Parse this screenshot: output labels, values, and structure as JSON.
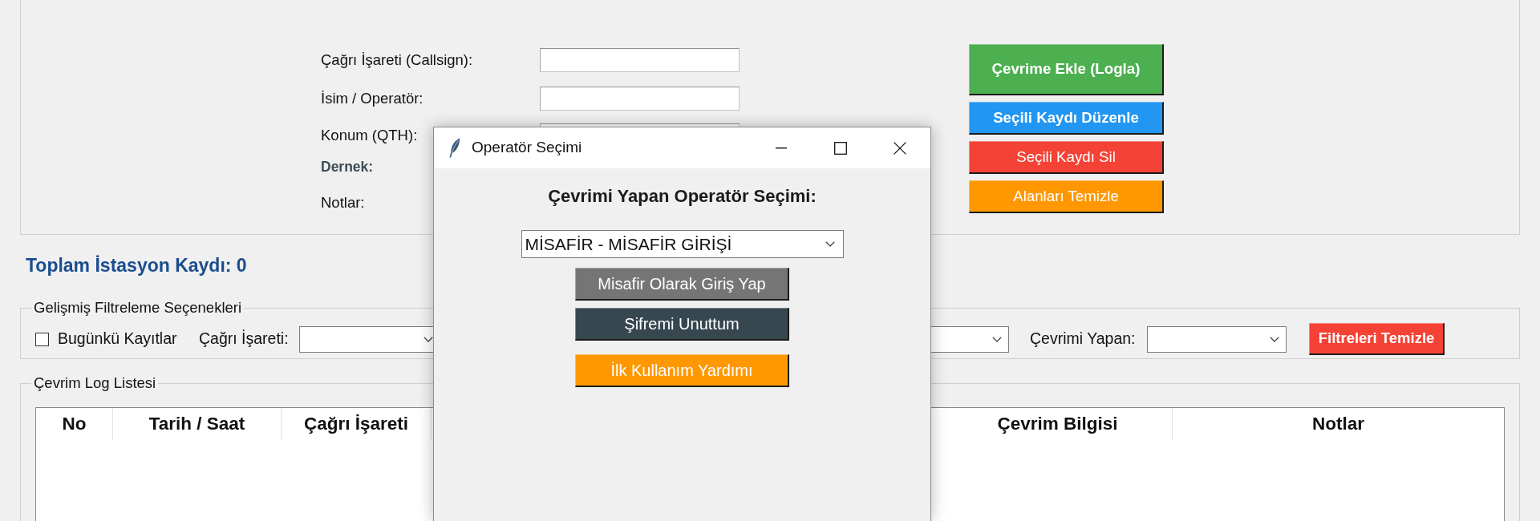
{
  "entry_form": {
    "fields": [
      {
        "label": "Çağrı İşareti (Callsign):",
        "kind": "entry"
      },
      {
        "label": "İsim / Operatör:",
        "kind": "entry"
      },
      {
        "label": "Konum (QTH):",
        "kind": "entry"
      },
      {
        "label": "Dernek:",
        "kind": "emphasis"
      },
      {
        "label": "Notlar:",
        "kind": "plain"
      }
    ],
    "actions": [
      {
        "label": "Çevrime Ekle (Logla)",
        "kind": "large",
        "bold": true,
        "color": "#4caf50"
      },
      {
        "label": "Seçili Kaydı Düzenle",
        "kind": "normal",
        "bold": true,
        "color": "#2196f3"
      },
      {
        "label": "Seçili Kaydı Sil",
        "kind": "normal",
        "bold": false,
        "color": "#f44336"
      },
      {
        "label": "Alanları Temizle",
        "kind": "normal",
        "bold": false,
        "color": "#ff9800"
      }
    ]
  },
  "record_count": "Toplam İstasyon Kaydı: 0",
  "filters": {
    "title": "Gelişmiş Filtreleme Seçenekleri",
    "items": [
      {
        "kind": "checkbox",
        "label": "Bugünkü Kayıtlar",
        "checked": false
      },
      {
        "kind": "label",
        "label": "Çağrı İşareti:"
      },
      {
        "kind": "dropdown"
      },
      {
        "kind": "dropdown"
      },
      {
        "kind": "label",
        "label": "Çevrimi Yapan:"
      },
      {
        "kind": "dropdown"
      },
      {
        "kind": "button",
        "label": "Filtreleri Temizle"
      }
    ]
  },
  "log_list": {
    "title": "Çevrim Log Listesi",
    "columns": [
      "No",
      "Tarih / Saat",
      "Çağrı İşareti",
      "Çevrim Bilgisi",
      "Notlar"
    ]
  },
  "dialog": {
    "title": "Operatör Seçimi",
    "heading": "Çevrimi Yapan Operatör Seçimi:",
    "operator": "MİSAFİR - MİSAFİR GİRİŞİ",
    "buttons": [
      {
        "label": "Misafir Olarak Giriş Yap",
        "color": "#757575"
      },
      {
        "label": "Şifremi Unuttum",
        "color": "#37474f"
      },
      {
        "label": "İlk Kullanım Yardımı",
        "color": "#ff9800"
      }
    ]
  }
}
